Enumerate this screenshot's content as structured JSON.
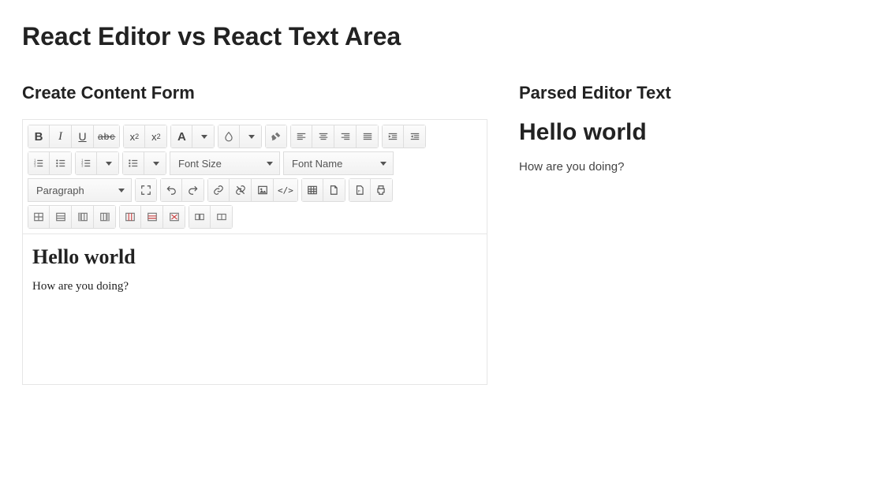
{
  "page_title": "React Editor vs React Text Area",
  "left_title": "Create Content Form",
  "right_title": "Parsed Editor Text",
  "font_size_label": "Font Size",
  "font_name_label": "Font Name",
  "paragraph_label": "Paragraph",
  "content_heading": "Hello world",
  "content_body": "How are you doing?",
  "sub_label_base": "x",
  "sub_label_sub": "2",
  "sup_label_base": "x",
  "sup_label_sup": "2",
  "letter_a": "A",
  "bold_b": "B",
  "italic_i": "I",
  "under_u": "U",
  "strike_abc": "abc",
  "code_label": "</>"
}
